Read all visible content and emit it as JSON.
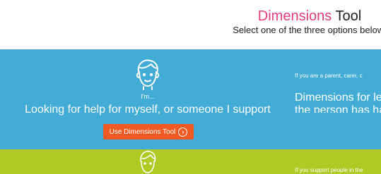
{
  "header": {
    "title_brand": "Dimensions",
    "title_rest": "Tool",
    "subtitle": "Select one of the three options below:"
  },
  "options": [
    {
      "color": "#42acd6",
      "icon": "person-face-icon",
      "pre_label": "I'm...",
      "heading": "Looking for help for myself, or someone I support",
      "button_label": "Use Dimensions Tool",
      "button_color": "#f05a22",
      "side_text_1": "If you are a parent, carer, c",
      "side_text_2": "Dimensions for learning dis the person has had a medi disability."
    },
    {
      "color": "#b1c924",
      "icon": "person-face-icon",
      "side_text_1": "If you support people in the"
    }
  ]
}
